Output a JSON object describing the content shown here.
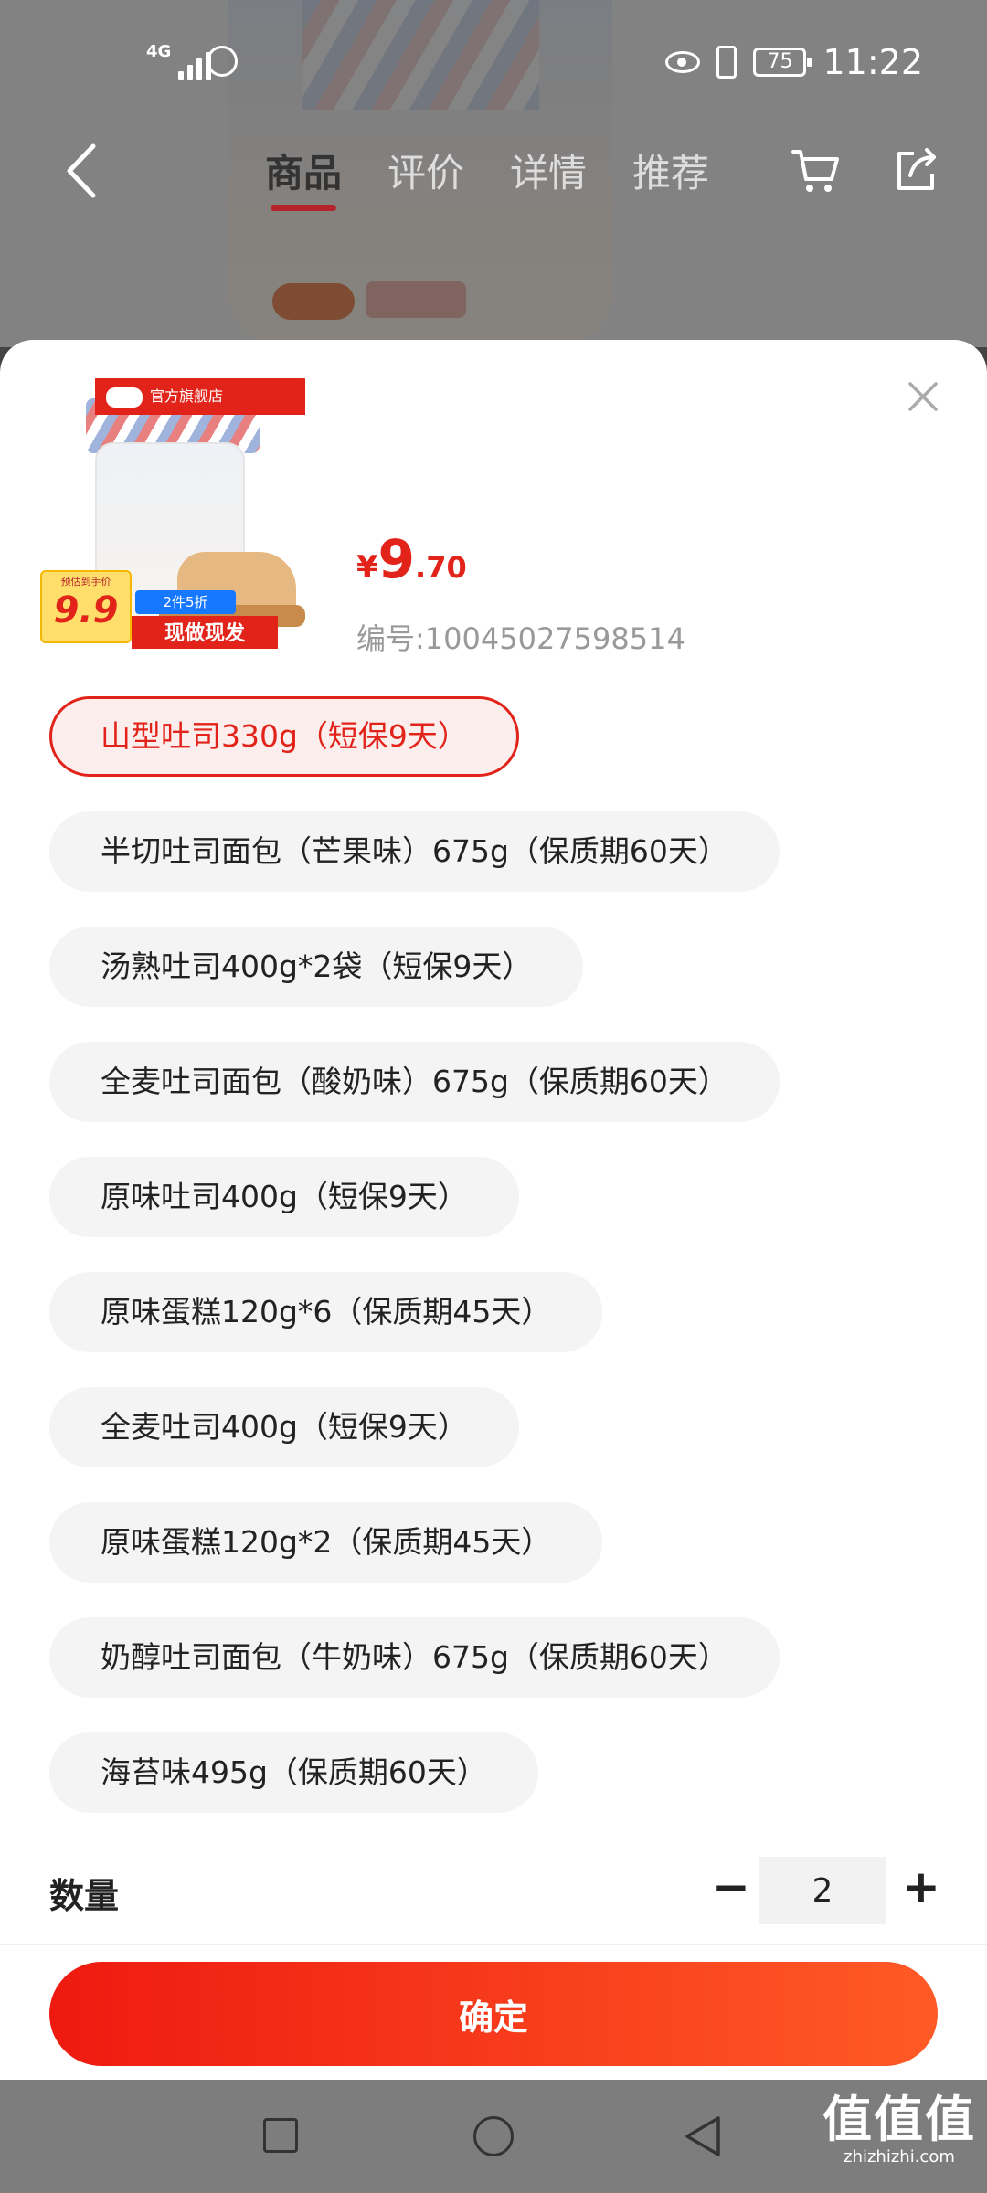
{
  "status_bar": {
    "network": "4G",
    "battery": "75",
    "time": "11:22"
  },
  "top_nav": {
    "tabs": [
      {
        "label": "商品",
        "active": true
      },
      {
        "label": "评价",
        "active": false
      },
      {
        "label": "详情",
        "active": false
      },
      {
        "label": "推荐",
        "active": false
      }
    ],
    "icons": [
      "back-arrow-icon",
      "cart-icon",
      "share-icon"
    ]
  },
  "sheet": {
    "product_image": {
      "store_flag": "官方旗舰店",
      "promo_label": "预估到手价",
      "promo_price": "9.9",
      "promo_badge": "2件5折",
      "promo_tag": "现做现发"
    },
    "price": {
      "currency": "¥",
      "integer": "9",
      "decimal": ".70"
    },
    "sku_number": "编号:10045027598514",
    "options": [
      {
        "label": "山型吐司330g（短保9天）",
        "selected": true
      },
      {
        "label": "半切吐司面包（芒果味）675g（保质期60天）",
        "selected": false
      },
      {
        "label": "汤熟吐司400g*2袋（短保9天）",
        "selected": false
      },
      {
        "label": "全麦吐司面包（酸奶味）675g（保质期60天）",
        "selected": false
      },
      {
        "label": "原味吐司400g（短保9天）",
        "selected": false
      },
      {
        "label": "原味蛋糕120g*6（保质期45天）",
        "selected": false
      },
      {
        "label": "全麦吐司400g（短保9天）",
        "selected": false
      },
      {
        "label": "原味蛋糕120g*2（保质期45天）",
        "selected": false
      },
      {
        "label": "奶醇吐司面包（牛奶味）675g（保质期60天）",
        "selected": false
      },
      {
        "label": "海苔味495g（保质期60天）",
        "selected": false
      }
    ],
    "quantity": {
      "label": "数量",
      "value": "2",
      "minus": "−",
      "plus": "+"
    },
    "confirm_label": "确定"
  },
  "watermark": {
    "text": "值值值",
    "site": "zhizhizhi.com"
  },
  "colors": {
    "accent": "#e2231a",
    "selected_bg": "#fdeeee",
    "option_bg": "#f4f4f4"
  }
}
